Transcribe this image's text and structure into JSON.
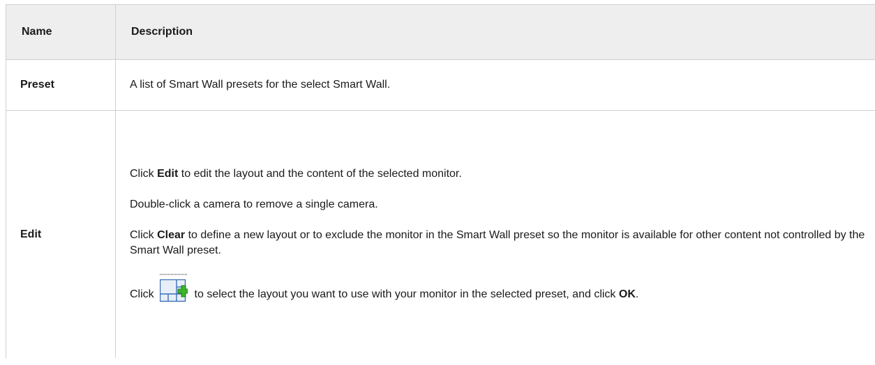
{
  "table": {
    "headers": {
      "name": "Name",
      "description": "Description"
    },
    "rows": [
      {
        "name": "Preset",
        "description": "A list of Smart Wall presets for the select Smart Wall."
      },
      {
        "name": "Edit",
        "p1": {
          "pre": "Click ",
          "bold": "Edit",
          "post": " to edit the layout and the content of the selected monitor."
        },
        "p2": "Double-click a camera to remove a single camera.",
        "p3": {
          "pre": "Click ",
          "bold": "Clear",
          "post": " to define a new layout or to exclude the monitor in the Smart Wall preset so the monitor is available for other content not controlled by the Smart Wall preset."
        },
        "p4": {
          "pre": "Click ",
          "post": " to select the layout you want to use with your monitor in the selected preset, and click ",
          "bold": "OK",
          "end": "."
        },
        "icon": "layout-add-icon"
      }
    ]
  },
  "colors": {
    "header_bg": "#eeeeee",
    "border": "#cfcfcf",
    "icon_green": "#3db42a"
  }
}
